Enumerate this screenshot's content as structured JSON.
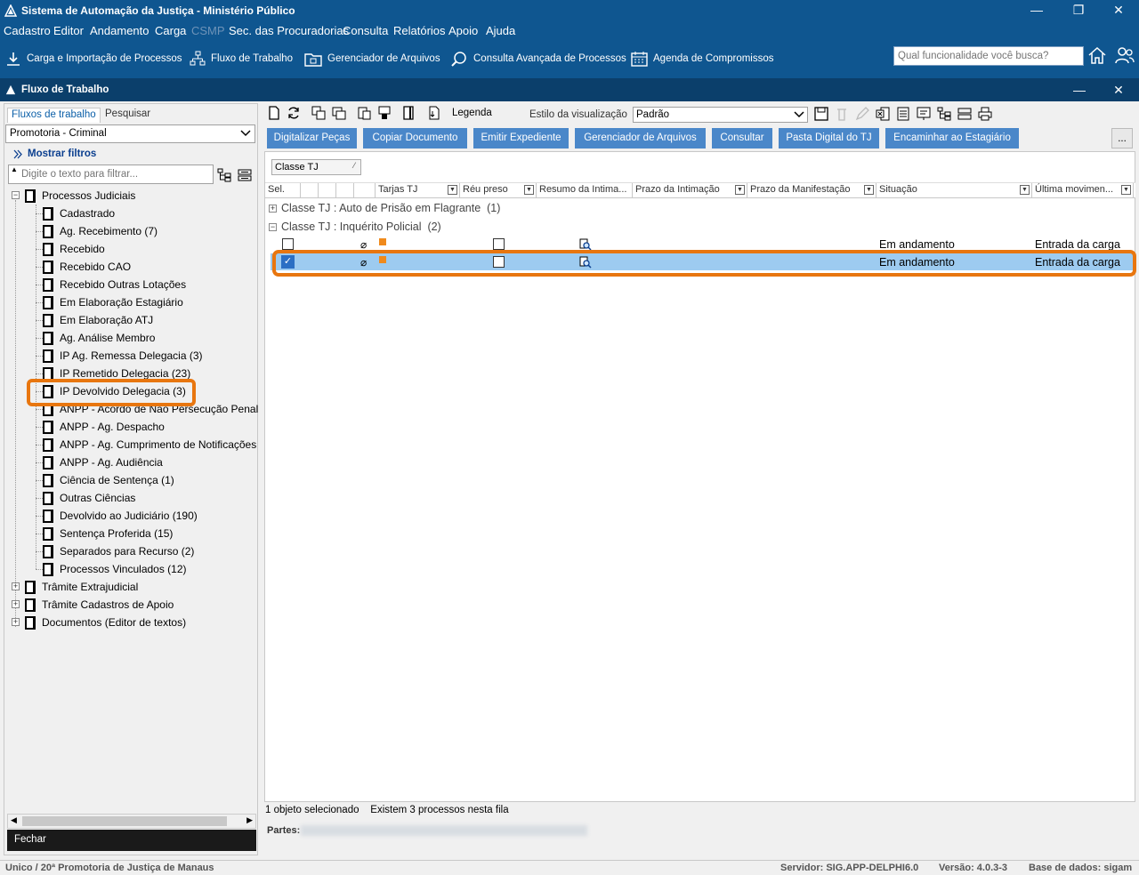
{
  "app": {
    "title": "Sistema de Automação da Justiça - Ministério Público"
  },
  "menu": [
    "Cadastro",
    "Editor",
    "Andamento",
    "Carga",
    "CSMP",
    "Sec. das Procuradorias",
    "Consulta",
    "Relatórios",
    "Apoio",
    "Ajuda"
  ],
  "shortcuts": [
    "Carga e Importação de Processos",
    "Fluxo de Trabalho",
    "Gerenciador de Arquivos",
    "Consulta Avançada de Processos",
    "Agenda de Compromissos"
  ],
  "search": {
    "placeholder": "Qual funcionalidade você busca?"
  },
  "child": {
    "title": "Fluxo de Trabalho"
  },
  "left": {
    "tabs": [
      "Fluxos de trabalho",
      "Pesquisar"
    ],
    "combo": "Promotoria - Criminal",
    "show_filters": "Mostrar filtros",
    "filter_placeholder": "Digite o texto para filtrar...",
    "root": "Processos Judiciais",
    "items": [
      "Cadastrado",
      "Ag. Recebimento (7)",
      "Recebido",
      "Recebido CAO",
      "Recebido Outras Lotações",
      "Em Elaboração Estagiário",
      "Em Elaboração ATJ",
      "Ag. Análise Membro",
      "IP Ag. Remessa Delegacia (3)",
      "IP Remetido Delegacia (23)",
      "IP Devolvido Delegacia (3)",
      "ANPP - Acordo de Não Persecução Penal",
      "ANPP - Ag. Despacho",
      "ANPP - Ag. Cumprimento de Notificações",
      "ANPP - Ag. Audiência",
      "Ciência de Sentença (1)",
      "Outras Ciências",
      "Devolvido ao Judiciário (190)",
      "Sentença Proferida (15)",
      "Separados para Recurso (2)",
      "Processos Vinculados (12)"
    ],
    "other_roots": [
      "Trâmite Extrajudicial",
      "Trâmite Cadastros de Apoio",
      "Documentos (Editor de textos)"
    ],
    "close": "Fechar"
  },
  "toolbar": {
    "legend": "Legenda",
    "view_style_label": "Estilo da visualização",
    "view_style": "Padrão"
  },
  "actions": [
    "Digitalizar Peças",
    "Copiar Documento",
    "Emitir Expediente",
    "Gerenciador de Arquivos",
    "Consultar",
    "Pasta Digital do TJ",
    "Encaminhar ao Estagiário"
  ],
  "more": "...",
  "group_chip": "Classe TJ",
  "columns": [
    "Sel.",
    "Tarjas TJ",
    "Réu preso",
    "Resumo da Intima...",
    "Prazo da Intimação",
    "Prazo da Manifestação",
    "Situação",
    "Última movimen..."
  ],
  "groups": [
    {
      "label": "Classe TJ : Auto de Prisão em Flagrante",
      "count": "(1)"
    },
    {
      "label": "Classe TJ : Inquérito Policial",
      "count": "(2)"
    }
  ],
  "rows": [
    {
      "situacao": "Em andamento",
      "ultima": "Entrada da carga",
      "selected": false
    },
    {
      "situacao": "Em andamento",
      "ultima": "Entrada da carga",
      "selected": true
    }
  ],
  "status": {
    "selected": "1 objeto selecionado",
    "count": "Existem 3 processos nesta fila",
    "partes": "Partes:"
  },
  "footer": {
    "left": "Unico / 20ª Promotoria de Justiça de Manaus",
    "server": "Servidor: SIG.APP-DELPHI6.0",
    "version": "Versão: 4.0.3-3",
    "db": "Base de dados: sigam"
  },
  "colors": {
    "primary": "#0f5690",
    "child": "#0b3f6b",
    "button": "#4a87c9",
    "highlight": "#e8760f",
    "selection": "#9dcbf0"
  }
}
